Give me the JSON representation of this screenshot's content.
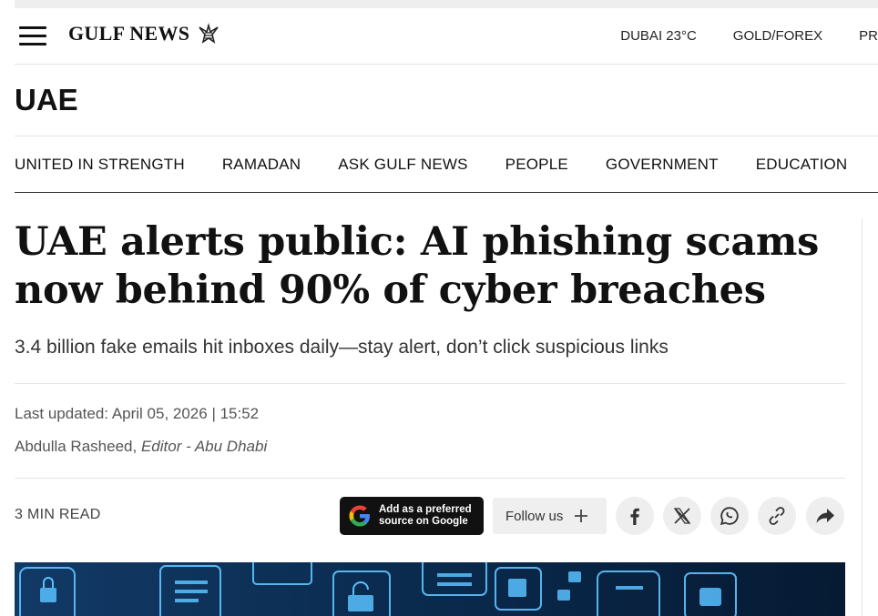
{
  "header": {
    "logo_text": "GULF NEWS",
    "links": [
      "DUBAI 23°C",
      "GOLD/FOREX",
      "PR"
    ]
  },
  "section": {
    "title": "UAE"
  },
  "subnav": {
    "items": [
      "UNITED IN STRENGTH",
      "RAMADAN",
      "ASK GULF NEWS",
      "PEOPLE",
      "GOVERNMENT",
      "EDUCATION"
    ]
  },
  "article": {
    "headline": "UAE alerts public: AI phishing scams now behind 90% of cyber breaches",
    "dek": "3.4 billion fake emails hit inboxes daily—stay alert, don’t click suspicious links",
    "last_updated": "Last updated: April 05, 2026 | 15:52",
    "author": "Abdulla Rasheed,",
    "author_role": "Editor - Abu Dhabi",
    "read_time": "3 MIN READ"
  },
  "actions": {
    "google_line1": "Add as a preferred",
    "google_line2": "source on Google",
    "follow_label": "Follow us"
  },
  "share_icons": [
    "facebook-icon",
    "x-twitter-icon",
    "whatsapp-icon",
    "copy-link-icon",
    "share-icon"
  ],
  "colors": {
    "text": "#111111",
    "muted": "#555555",
    "button_dark": "#111111",
    "button_light": "#efefef",
    "hero": "#0b2440"
  }
}
